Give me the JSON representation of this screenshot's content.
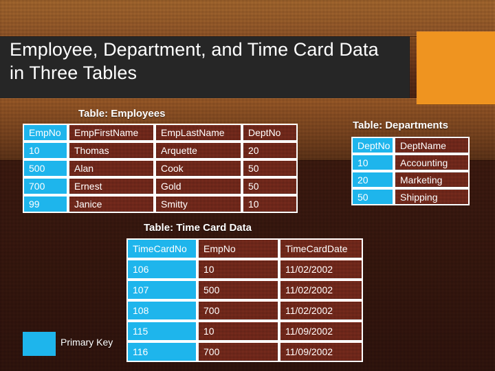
{
  "slide": {
    "title": "Employee, Department, and Time Card Data\nin Three Tables"
  },
  "colors": {
    "title_bar": "#262626",
    "accent_block": "#ef9420",
    "primary_key": "#1eb5ec",
    "cell_background": "#7a2519",
    "grid_line": "#ffffff",
    "text": "#ffffff"
  },
  "legend": {
    "label": "Primary Key",
    "swatch_color": "#1eb5ec"
  },
  "tables": {
    "employees": {
      "caption": "Table: Employees",
      "primary_key_column": "EmpNo",
      "columns": [
        "EmpNo",
        "EmpFirstName",
        "EmpLastName",
        "DeptNo"
      ],
      "rows": [
        [
          "10",
          "Thomas",
          "Arquette",
          "20"
        ],
        [
          "500",
          "Alan",
          "Cook",
          "50"
        ],
        [
          "700",
          "Ernest",
          "Gold",
          "50"
        ],
        [
          "99",
          "Janice",
          "Smitty",
          "10"
        ]
      ]
    },
    "departments": {
      "caption": "Table: Departments",
      "primary_key_column": "DeptNo",
      "columns": [
        "DeptNo",
        "DeptName"
      ],
      "rows": [
        [
          "10",
          "Accounting"
        ],
        [
          "20",
          "Marketing"
        ],
        [
          "50",
          "Shipping"
        ]
      ]
    },
    "timecard": {
      "caption": "Table: Time Card Data",
      "primary_key_column": "TimeCardNo",
      "columns": [
        "TimeCardNo",
        "EmpNo",
        "TimeCardDate"
      ],
      "rows": [
        [
          "106",
          "10",
          "11/02/2002"
        ],
        [
          "107",
          "500",
          "11/02/2002"
        ],
        [
          "108",
          "700",
          "11/02/2002"
        ],
        [
          "115",
          "10",
          "11/09/2002"
        ],
        [
          "116",
          "700",
          "11/09/2002"
        ]
      ]
    }
  }
}
